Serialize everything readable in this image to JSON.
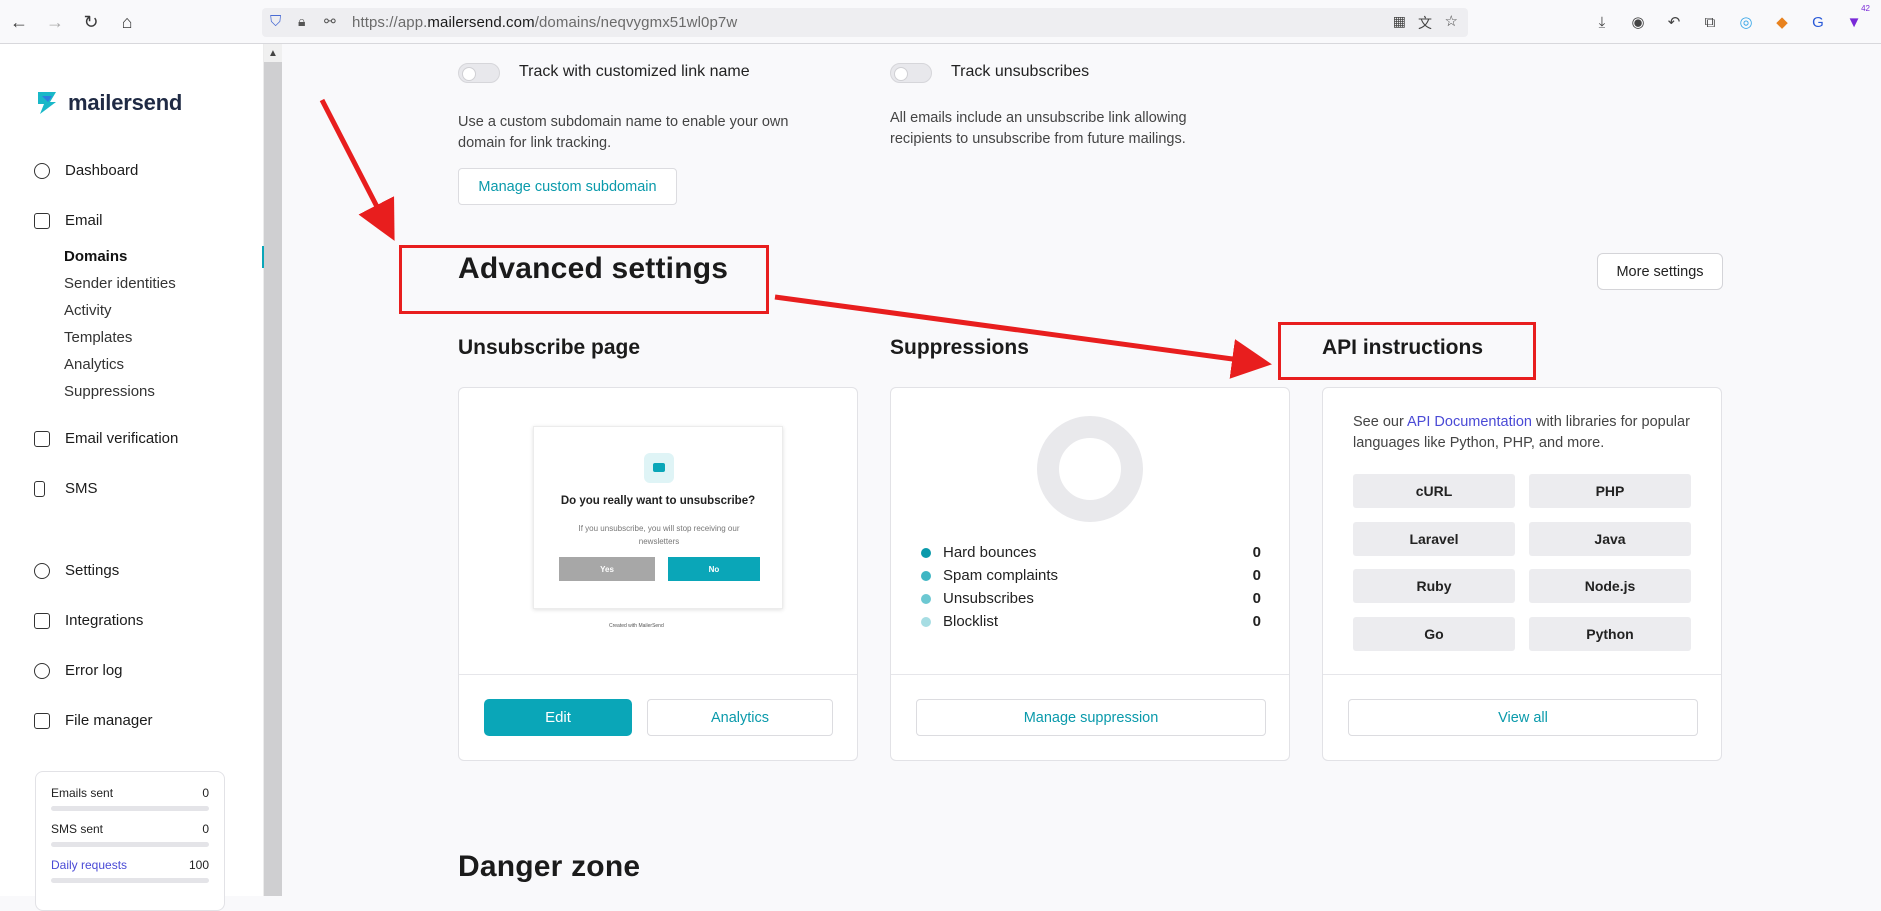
{
  "browser": {
    "url_prefix": "https://app.",
    "url_domain": "mailersend.com",
    "url_path": "/domains/neqvygmx51wl0p7w",
    "extension_badge": "42"
  },
  "sidebar": {
    "brand": "mailersend",
    "nav": [
      {
        "label": "Dashboard"
      },
      {
        "label": "Email"
      },
      {
        "label": "Email verification"
      },
      {
        "label": "SMS"
      },
      {
        "label": "Settings"
      },
      {
        "label": "Integrations"
      },
      {
        "label": "Error log"
      },
      {
        "label": "File manager"
      }
    ],
    "email_sub": [
      {
        "label": "Domains"
      },
      {
        "label": "Sender identities"
      },
      {
        "label": "Activity"
      },
      {
        "label": "Templates"
      },
      {
        "label": "Analytics"
      },
      {
        "label": "Suppressions"
      }
    ],
    "usage": [
      {
        "label": "Emails sent",
        "value": "0"
      },
      {
        "label": "SMS sent",
        "value": "0"
      },
      {
        "label": "Daily requests",
        "value": "100"
      }
    ]
  },
  "tracking": {
    "custom_link_label": "Track with customized link name",
    "custom_link_desc": "Use a custom subdomain name to enable your own domain for link tracking.",
    "manage_subdomain": "Manage custom subdomain",
    "unsub_label": "Track unsubscribes",
    "unsub_desc": "All emails include an unsubscribe link allowing recipients to unsubscribe from future mailings."
  },
  "advanced": {
    "title": "Advanced settings",
    "more_settings": "More settings"
  },
  "unsubscribe_page": {
    "title": "Unsubscribe page",
    "preview_title": "Do you really want to unsubscribe?",
    "preview_text": "If you unsubscribe, you will stop receiving our newsletters",
    "preview_yes": "Yes",
    "preview_no": "No",
    "preview_footer": "Created with MailerSend",
    "edit": "Edit",
    "analytics": "Analytics"
  },
  "suppressions": {
    "title": "Suppressions",
    "items": [
      {
        "label": "Hard bounces",
        "value": "0",
        "color": "#0a9aab"
      },
      {
        "label": "Spam complaints",
        "value": "0",
        "color": "#3fb6c3"
      },
      {
        "label": "Unsubscribes",
        "value": "0",
        "color": "#6cc8d2"
      },
      {
        "label": "Blocklist",
        "value": "0",
        "color": "#a6dde3"
      }
    ],
    "manage": "Manage suppression"
  },
  "api": {
    "title": "API instructions",
    "desc_pre": "See our ",
    "desc_link": "API Documentation",
    "desc_post": " with libraries for popular languages like Python, PHP, and more.",
    "languages": [
      "cURL",
      "PHP",
      "Laravel",
      "Java",
      "Ruby",
      "Node.js",
      "Go",
      "Python"
    ],
    "view_all": "View all"
  },
  "danger": {
    "title": "Danger zone"
  }
}
